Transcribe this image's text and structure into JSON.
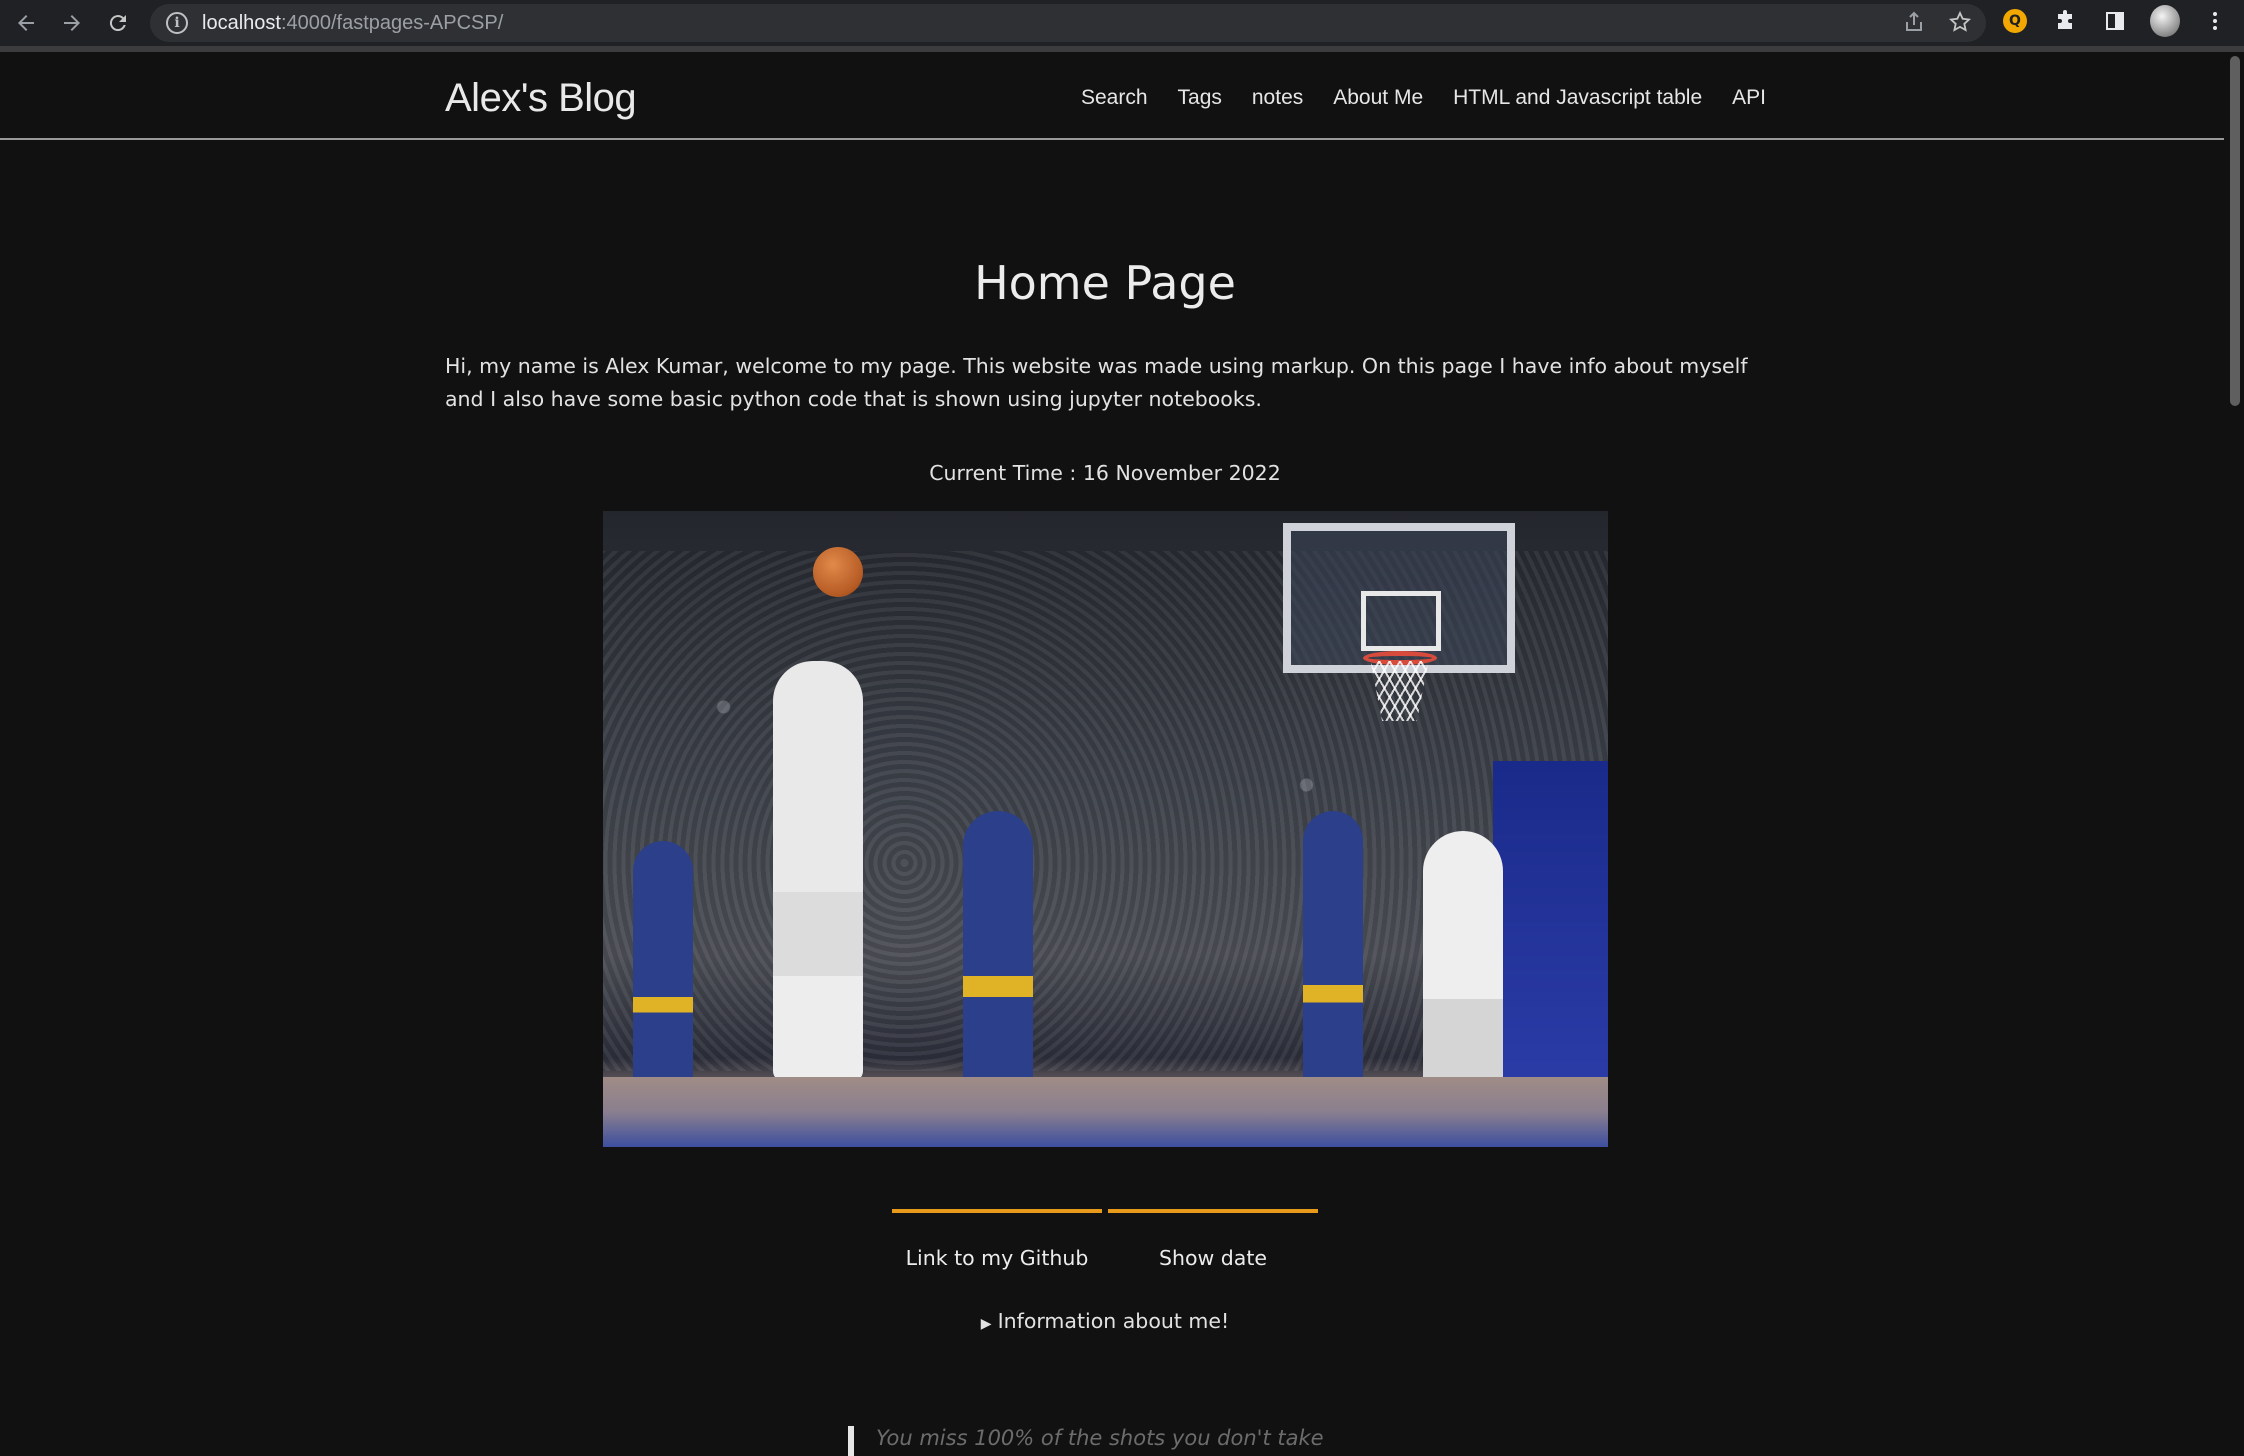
{
  "browser": {
    "url_host": "localhost",
    "url_path": ":4000/fastpages-APCSP/"
  },
  "site": {
    "title": "Alex's Blog",
    "nav": [
      "Search",
      "Tags",
      "notes",
      "About Me",
      "HTML and Javascript table",
      "API"
    ]
  },
  "main": {
    "heading": "Home Page",
    "intro": "Hi, my name is Alex Kumar, welcome to my page. This website was made using markup. On this page I have info about myself and I also have some basic python code that is shown using jupyter notebooks.",
    "current_time": "Current Time : 16 November 2022",
    "buttons": {
      "github": "Link to my Github",
      "show_date": "Show date"
    },
    "details_summary": "Information about me!",
    "quote_partial": "You miss 100% of the shots you don't take"
  },
  "colors": {
    "background": "#111111",
    "accent": "#e89b1a"
  }
}
